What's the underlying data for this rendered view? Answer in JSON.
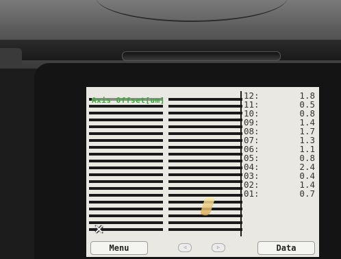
{
  "screen": {
    "title": "Axis Offset[um]",
    "close_icon": "x-icon",
    "close_glyph": "✕",
    "readings": [
      {
        "index": "12:",
        "value": "1.8"
      },
      {
        "index": "11:",
        "value": "0.5"
      },
      {
        "index": "10:",
        "value": "0.8"
      },
      {
        "index": "09:",
        "value": "1.4"
      },
      {
        "index": "08:",
        "value": "1.7"
      },
      {
        "index": "07:",
        "value": "1.3"
      },
      {
        "index": "06:",
        "value": "1.1"
      },
      {
        "index": "05:",
        "value": "0.8"
      },
      {
        "index": "04:",
        "value": "2.4"
      },
      {
        "index": "03:",
        "value": "0.4"
      },
      {
        "index": "02:",
        "value": "1.4"
      },
      {
        "index": "01:",
        "value": "0.7"
      }
    ],
    "buttons": {
      "menu_label": "Menu",
      "data_label": "Data",
      "prev_glyph": "◁",
      "next_glyph": "▷"
    }
  }
}
